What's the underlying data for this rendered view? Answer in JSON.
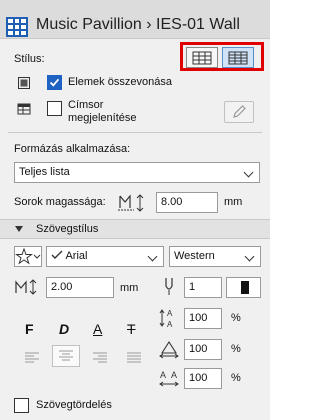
{
  "title": "Music Pavillion › IES-01  Wall",
  "style": {
    "label": "Stílus:",
    "merge_label": "Elemek összevonása",
    "merge_checked": true,
    "header_label_line1": "Címsor",
    "header_label_line2": "megjelenítése",
    "header_checked": false
  },
  "format": {
    "label": "Formázás alkalmazása:",
    "value": "Teljes lista"
  },
  "row_height": {
    "label": "Sorok magassága:",
    "value": "8.00",
    "unit": "mm"
  },
  "text_style": {
    "header": "Szövegstílus",
    "font": "Arial",
    "script": "Western",
    "size": "2.00",
    "size_unit": "mm",
    "pen": "1",
    "line_spacing": "100",
    "char_width": "100",
    "char_spacing": "100",
    "pct": "%",
    "bold": "F",
    "italic": "D",
    "underline": "A",
    "strike": "T"
  },
  "wrap": {
    "label": "Szövegtördelés",
    "checked": false
  }
}
